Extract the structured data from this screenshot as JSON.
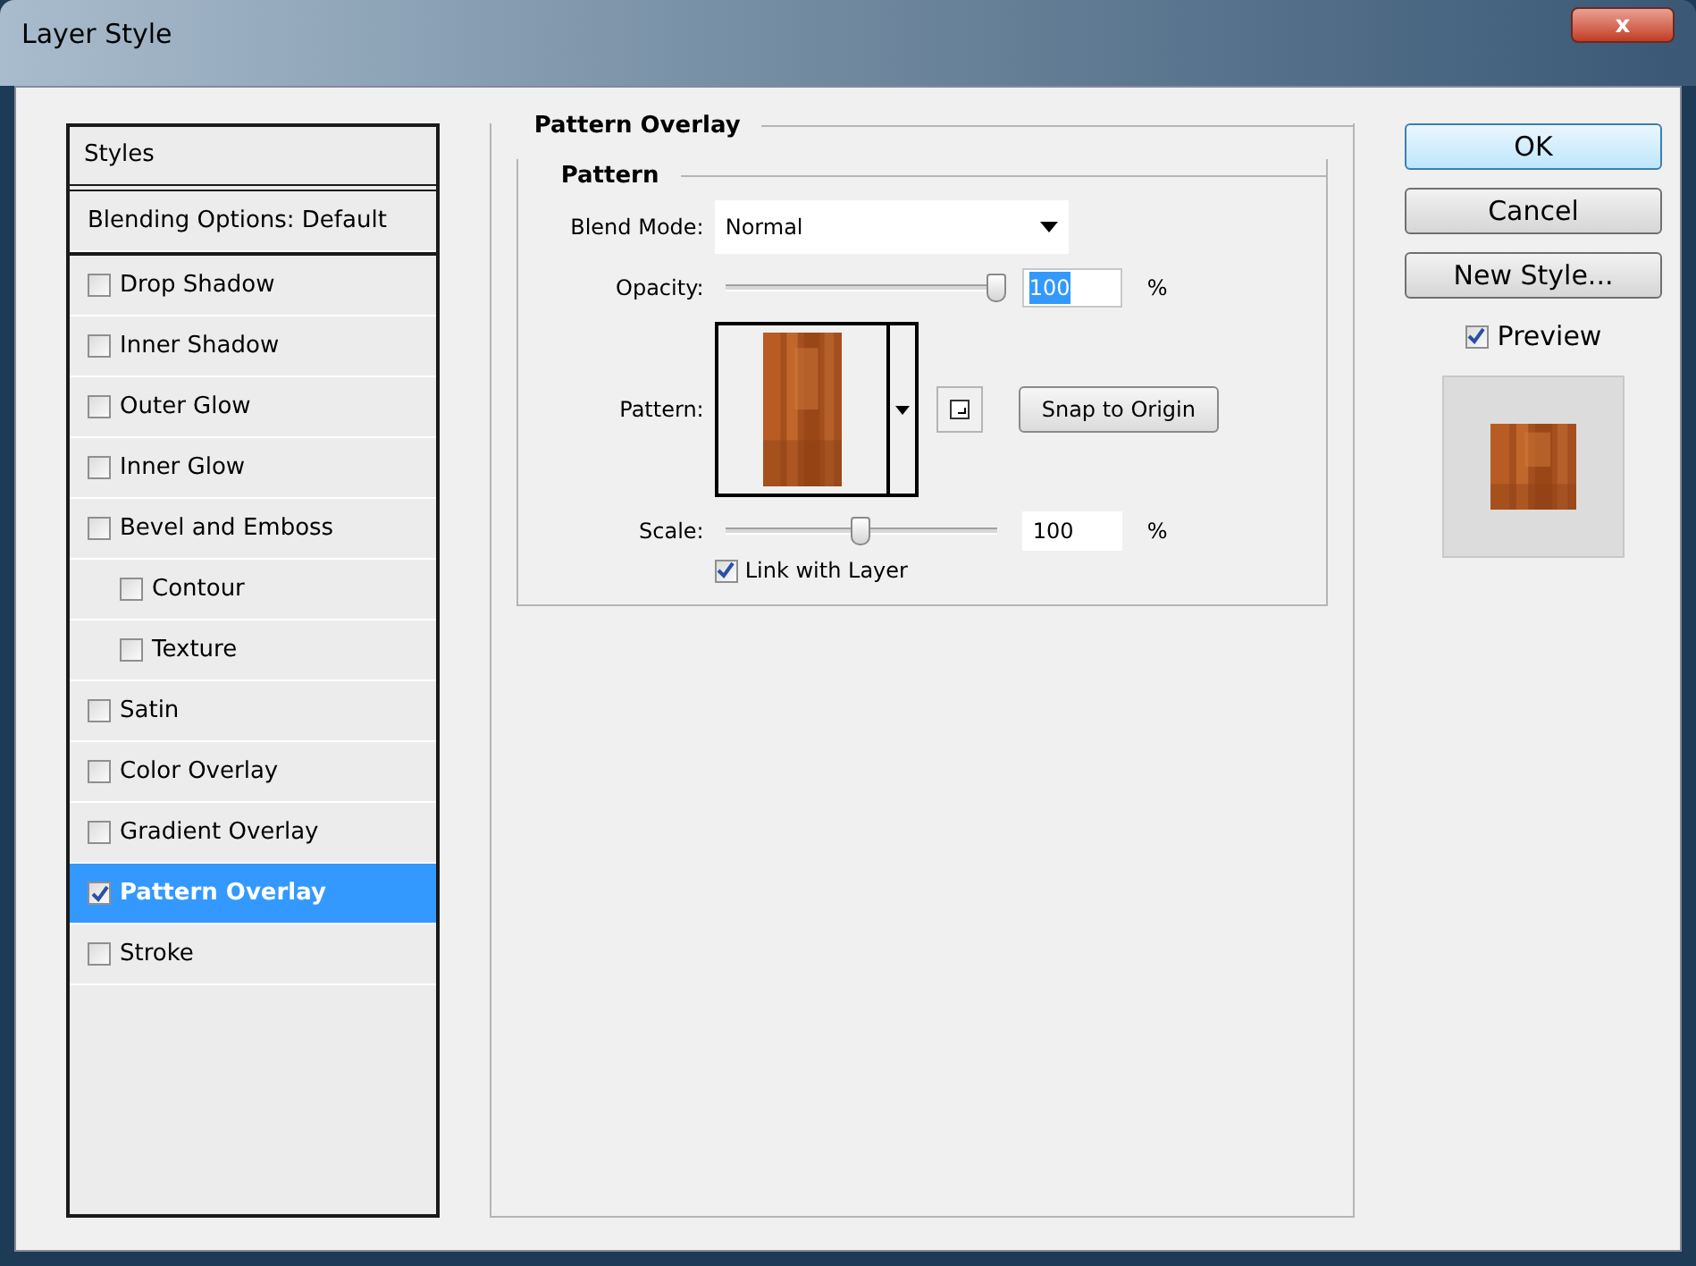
{
  "window": {
    "title": "Layer Style",
    "close_label": "x"
  },
  "styles_list": {
    "title": "Styles",
    "items": [
      {
        "label": "Blending Options: Default",
        "kind": "plain",
        "selected": false
      },
      {
        "label": "Drop Shadow",
        "kind": "check",
        "checked": false,
        "selected": false
      },
      {
        "label": "Inner Shadow",
        "kind": "check",
        "checked": false,
        "selected": false
      },
      {
        "label": "Outer Glow",
        "kind": "check",
        "checked": false,
        "selected": false
      },
      {
        "label": "Inner Glow",
        "kind": "check",
        "checked": false,
        "selected": false
      },
      {
        "label": "Bevel and Emboss",
        "kind": "check",
        "checked": false,
        "selected": false,
        "children": [
          {
            "label": "Contour",
            "kind": "check",
            "checked": false,
            "selected": false
          },
          {
            "label": "Texture",
            "kind": "check",
            "checked": false,
            "selected": false
          }
        ]
      },
      {
        "label": "Satin",
        "kind": "check",
        "checked": false,
        "selected": false
      },
      {
        "label": "Color Overlay",
        "kind": "check",
        "checked": false,
        "selected": false
      },
      {
        "label": "Gradient Overlay",
        "kind": "check",
        "checked": false,
        "selected": false
      },
      {
        "label": "Pattern Overlay",
        "kind": "check",
        "checked": true,
        "selected": true
      },
      {
        "label": "Stroke",
        "kind": "check",
        "checked": false,
        "selected": false
      }
    ]
  },
  "panel": {
    "title": "Pattern Overlay",
    "group_title": "Pattern",
    "blend_mode": {
      "label": "Blend Mode:",
      "value": "Normal"
    },
    "opacity": {
      "label": "Opacity:",
      "level": 1.0,
      "value": "100",
      "unit": "%"
    },
    "pattern": {
      "label": "Pattern:",
      "snap_button": "Snap to Origin"
    },
    "scale": {
      "label": "Scale:",
      "level": 0.5,
      "value": "100",
      "unit": "%"
    },
    "link_with_layer": {
      "label": "Link with Layer",
      "checked": true
    }
  },
  "buttons": [
    "OK",
    "Cancel",
    "New Style..."
  ],
  "preview": {
    "label": "Preview",
    "checked": true
  }
}
